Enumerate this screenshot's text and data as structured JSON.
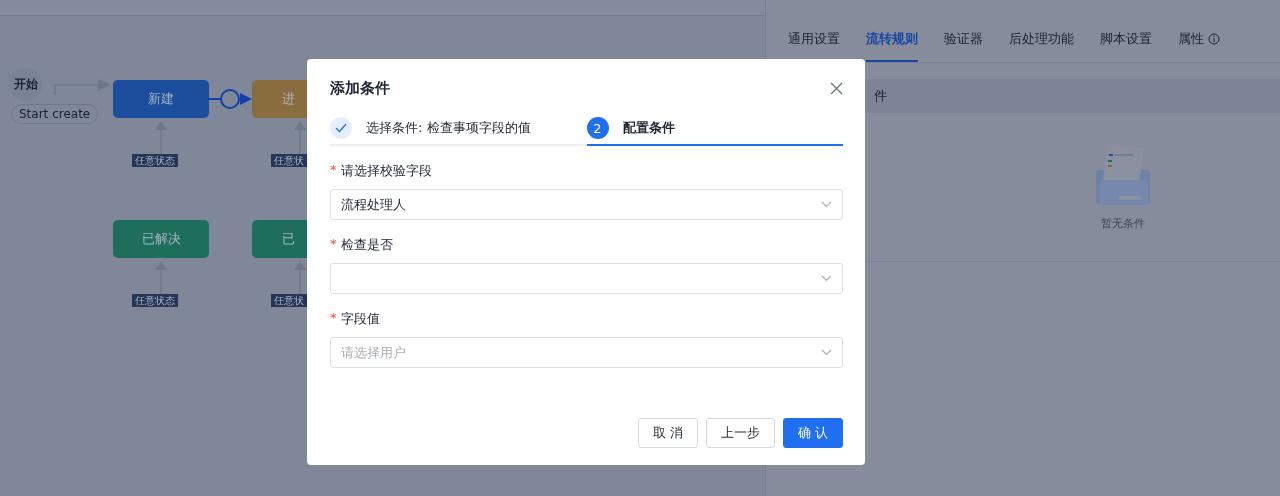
{
  "canvas": {
    "start": {
      "label": "开始",
      "transition": "Start create"
    },
    "nodes": [
      {
        "label": "新建",
        "color": "#1b4f9e",
        "any_state": "任意状态"
      },
      {
        "label": "进",
        "color": "#8a6d3e",
        "any_state": "任意状"
      },
      {
        "label": "已解决",
        "color": "#1e6e5c",
        "any_state": "任意状态"
      },
      {
        "label": "已",
        "color": "#1e6e5c",
        "any_state": "任意状"
      }
    ]
  },
  "panel": {
    "tabs": [
      {
        "label": "通用设置",
        "selected": false,
        "info": false
      },
      {
        "label": "流转规则",
        "selected": true,
        "info": false
      },
      {
        "label": "验证器",
        "selected": false,
        "info": false
      },
      {
        "label": "后处理功能",
        "selected": false,
        "info": false
      },
      {
        "label": "脚本设置",
        "selected": false,
        "info": false
      },
      {
        "label": "属性",
        "selected": false,
        "info": true
      }
    ],
    "section_title": "件",
    "empty_text": "暂无条件"
  },
  "modal": {
    "title": "添加条件",
    "steps": [
      {
        "label": "选择条件: 检查事项字段的值",
        "done": true,
        "selected": false
      },
      {
        "label": "配置条件",
        "number": "2",
        "done": false,
        "selected": true
      }
    ],
    "fields": [
      {
        "label": "请选择校验字段",
        "required_mark": "*",
        "value": "流程处理人"
      },
      {
        "label": "检查是否",
        "required_mark": "*"
      },
      {
        "label": "字段值",
        "required_mark": "*",
        "placeholder": "请选择用户"
      }
    ],
    "buttons": [
      {
        "label": "取 消",
        "kind": "default"
      },
      {
        "label": "上一步",
        "kind": "default"
      },
      {
        "label": "确 认",
        "kind": "primary"
      }
    ]
  }
}
